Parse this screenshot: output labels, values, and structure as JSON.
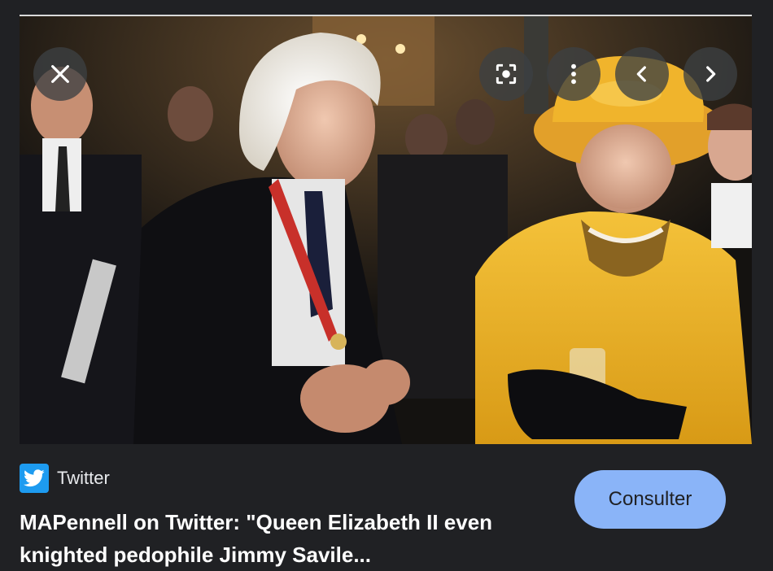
{
  "viewer": {
    "close_label": "Close",
    "lens_label": "Search inside image",
    "more_label": "More options",
    "prev_label": "Previous",
    "next_label": "Next"
  },
  "source": {
    "logo": "twitter-bird-icon",
    "name": "Twitter"
  },
  "result": {
    "title": "MAPennell on Twitter: \"Queen Elizabeth II even knighted pedophile Jimmy Savile..."
  },
  "actions": {
    "visit_label": "Consulter"
  },
  "colors": {
    "background": "#202124",
    "button": "#8ab4f8",
    "twitter": "#1d9bf0"
  }
}
